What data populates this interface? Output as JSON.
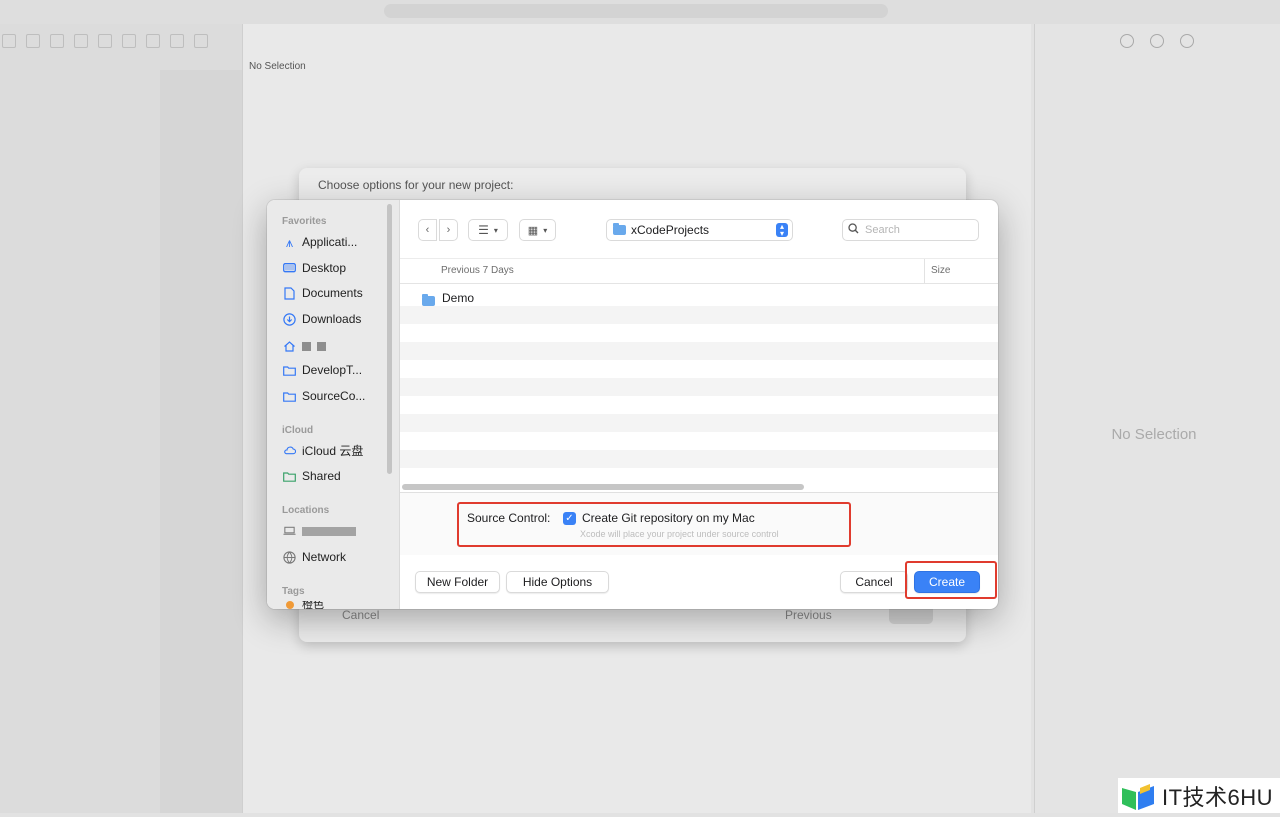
{
  "xcode": {
    "center_placeholder": "No Selection",
    "inspector_placeholder": "No Selection"
  },
  "behind_sheet": {
    "title": "Choose options for your new project:",
    "cancel_label": "Cancel",
    "previous_label": "Previous"
  },
  "sidebar": {
    "favorites_heading": "Favorites",
    "favorites": [
      {
        "label": "Applicati...",
        "icon": "applications-icon"
      },
      {
        "label": "Desktop",
        "icon": "desktop-icon"
      },
      {
        "label": "Documents",
        "icon": "document-icon"
      },
      {
        "label": "Downloads",
        "icon": "download-icon"
      },
      {
        "label": "",
        "icon": "home-icon"
      },
      {
        "label": "DevelopT...",
        "icon": "folder-icon"
      },
      {
        "label": "SourceCo...",
        "icon": "folder-icon"
      }
    ],
    "icloud_heading": "iCloud",
    "icloud": [
      {
        "label": "iCloud 云盘",
        "icon": "cloud-icon"
      },
      {
        "label": "Shared",
        "icon": "shared-folder-icon"
      }
    ],
    "locations_heading": "Locations",
    "locations": [
      {
        "label": "",
        "icon": "computer-icon"
      },
      {
        "label": "Network",
        "icon": "network-icon"
      }
    ],
    "tags_heading": "Tags",
    "tag_partial": "橙色"
  },
  "toolbar": {
    "current_folder": "xCodeProjects",
    "search_placeholder": "Search"
  },
  "file_list": {
    "column_name": "Previous 7 Days",
    "column_size": "Size",
    "rows": [
      {
        "name": "Demo",
        "kind": "folder"
      }
    ]
  },
  "options": {
    "source_control_label": "Source Control:",
    "git_checkbox_label": "Create Git repository on my Mac",
    "git_checked": true,
    "git_hint": "Xcode will place your project under source control"
  },
  "footer": {
    "new_folder": "New Folder",
    "hide_options": "Hide Options",
    "cancel": "Cancel",
    "create": "Create"
  },
  "watermark": {
    "text": "IT技术6HU"
  },
  "colors": {
    "accent": "#3a82f6",
    "highlight": "#e03b2e"
  }
}
